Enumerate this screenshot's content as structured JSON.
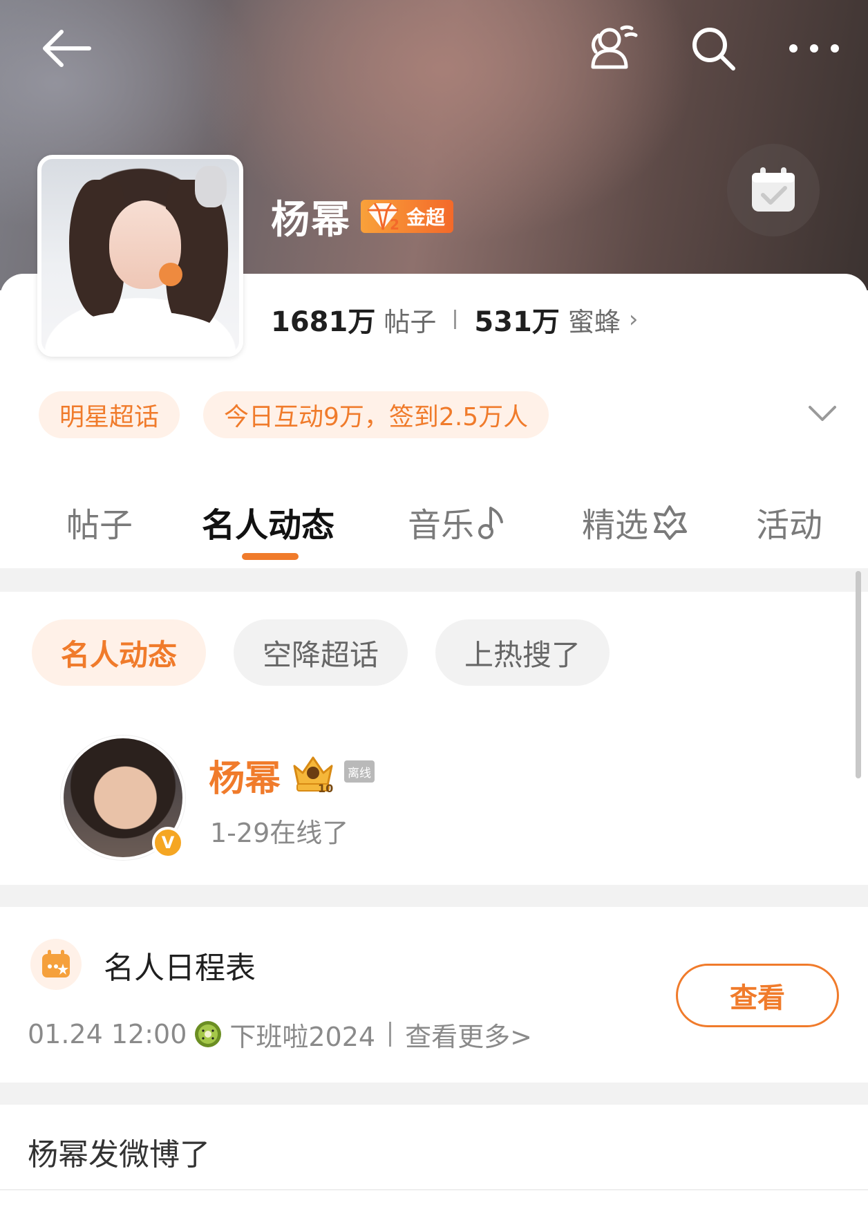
{
  "header": {
    "back_icon": "arrow-left-icon",
    "actions": [
      {
        "icon": "person-group-icon"
      },
      {
        "icon": "search-icon"
      },
      {
        "icon": "more-icon"
      }
    ],
    "checkin_icon": "calendar-check-icon"
  },
  "profile": {
    "name": "杨幂",
    "tier_badge": {
      "level": "2",
      "label": "金超"
    },
    "stats": [
      {
        "value": "1681万",
        "label": "帖子"
      },
      {
        "value": "531万",
        "label": "蜜蜂"
      }
    ],
    "stats_more": "›"
  },
  "tags": [
    "明星超话",
    "今日互动9万，签到2.5万人"
  ],
  "tabs": [
    {
      "label": "帖子",
      "active": false
    },
    {
      "label": "名人动态",
      "active": true
    },
    {
      "label": "音乐",
      "active": false
    },
    {
      "label": "精选",
      "active": false
    },
    {
      "label": "活动",
      "active": false
    }
  ],
  "chips": [
    {
      "label": "名人动态",
      "active": true
    },
    {
      "label": "空降超话",
      "active": false
    },
    {
      "label": "上热搜了",
      "active": false
    }
  ],
  "celebrity": {
    "name": "杨幂",
    "crown_level": "10",
    "offline_label": "离线",
    "status": "1-29在线了",
    "verified_mark": "V"
  },
  "schedule": {
    "title": "名人日程表",
    "datetime": "01.24 12:00",
    "event": "下班啦2024",
    "more_link": "查看更多>",
    "view_button": "查看"
  },
  "post": {
    "title": "杨幂发微博了"
  },
  "colors": {
    "accent": "#f07b2b",
    "accent_bg": "#fff1e8",
    "text_dark": "#1f1f1f",
    "text_gray": "#8a8a8a"
  }
}
